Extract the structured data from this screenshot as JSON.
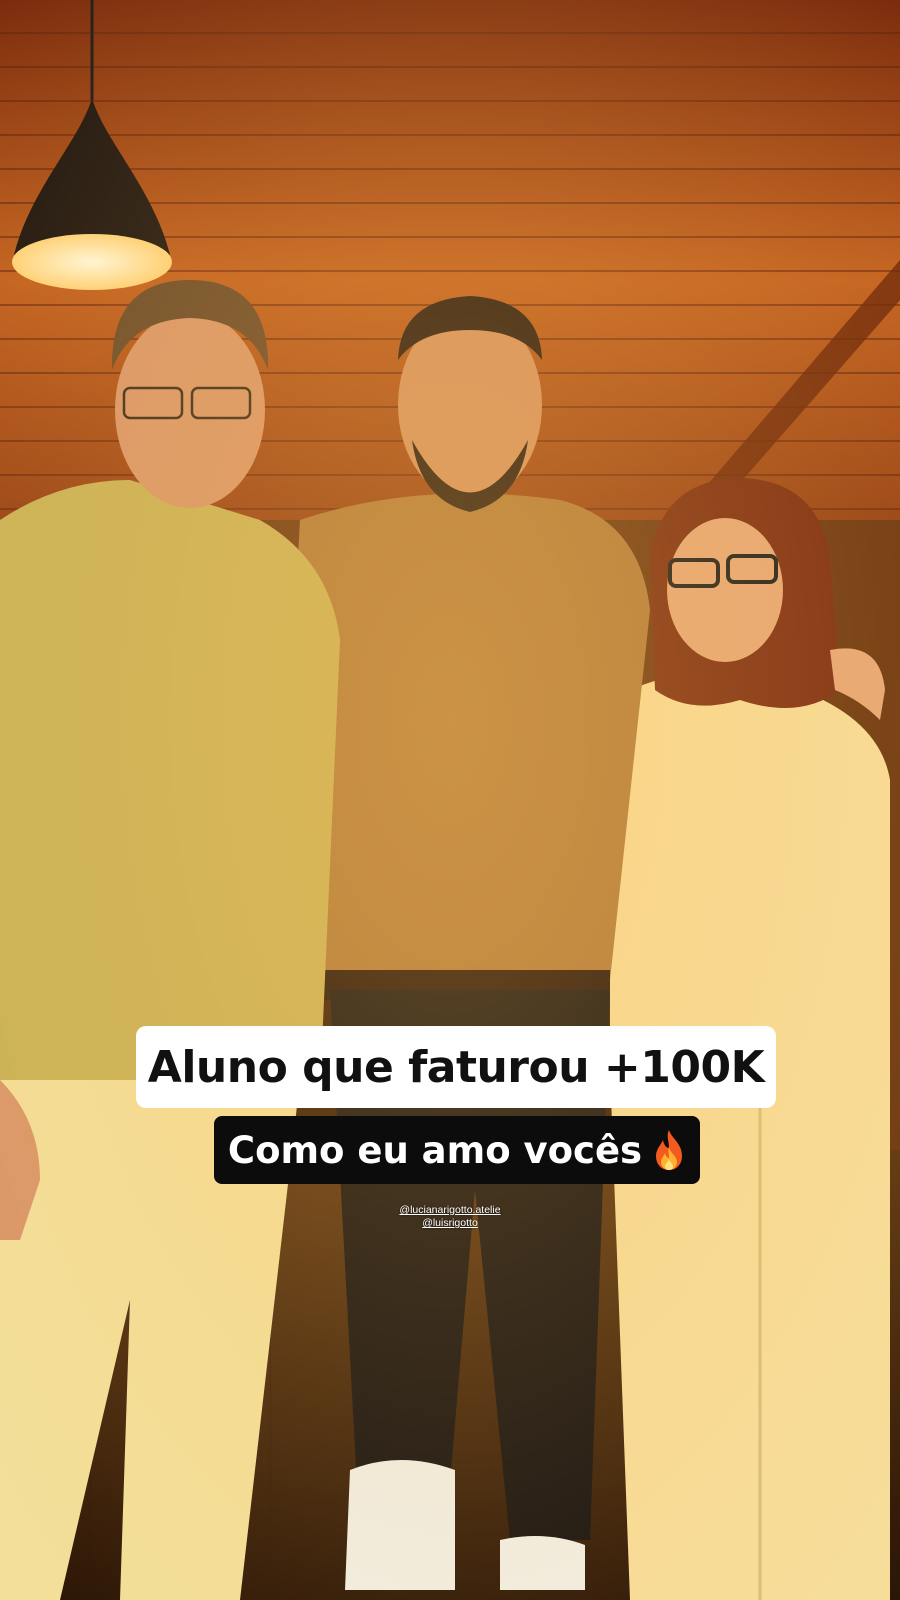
{
  "story": {
    "caption_primary": "Aluno que faturou +100K",
    "caption_secondary": "Como eu amo vocês",
    "caption_secondary_emoji": "fire-icon",
    "mentions": [
      "@lucianarigotto.atelie",
      "@luisrigotto"
    ]
  },
  "colors": {
    "caption_primary_bg": "#ffffff",
    "caption_primary_text": "#111111",
    "caption_secondary_bg": "#0c0c0c",
    "caption_secondary_text": "#ffffff",
    "ceiling_wood": "#b5501c",
    "ambient_light": "#f3a640"
  }
}
